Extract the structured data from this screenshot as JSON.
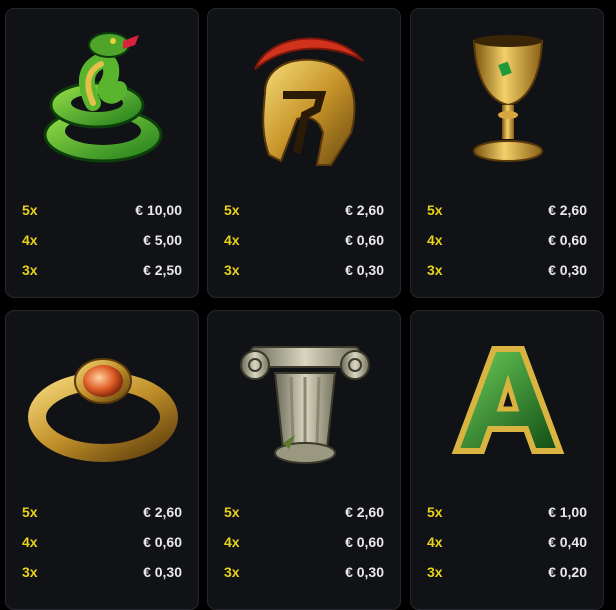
{
  "symbols": [
    {
      "icon": "snake-icon",
      "payouts": [
        {
          "mult": "5x",
          "amount": "€ 10,00"
        },
        {
          "mult": "4x",
          "amount": "€ 5,00"
        },
        {
          "mult": "3x",
          "amount": "€ 2,50"
        }
      ]
    },
    {
      "icon": "spartan-helmet-icon",
      "payouts": [
        {
          "mult": "5x",
          "amount": "€ 2,60"
        },
        {
          "mult": "4x",
          "amount": "€ 0,60"
        },
        {
          "mult": "3x",
          "amount": "€ 0,30"
        }
      ]
    },
    {
      "icon": "golden-chalice-icon",
      "payouts": [
        {
          "mult": "5x",
          "amount": "€ 2,60"
        },
        {
          "mult": "4x",
          "amount": "€ 0,60"
        },
        {
          "mult": "3x",
          "amount": "€ 0,30"
        }
      ]
    },
    {
      "icon": "gold-ring-icon",
      "payouts": [
        {
          "mult": "5x",
          "amount": "€ 2,60"
        },
        {
          "mult": "4x",
          "amount": "€ 0,60"
        },
        {
          "mult": "3x",
          "amount": "€ 0,30"
        }
      ]
    },
    {
      "icon": "ionic-column-icon",
      "payouts": [
        {
          "mult": "5x",
          "amount": "€ 2,60"
        },
        {
          "mult": "4x",
          "amount": "€ 0,60"
        },
        {
          "mult": "3x",
          "amount": "€ 0,30"
        }
      ]
    },
    {
      "icon": "letter-a-icon",
      "payouts": [
        {
          "mult": "5x",
          "amount": "€ 1,00"
        },
        {
          "mult": "4x",
          "amount": "€ 0,40"
        },
        {
          "mult": "3x",
          "amount": "€ 0,20"
        }
      ]
    }
  ],
  "colors": {
    "background": "#000000",
    "card": "#111216",
    "multiplier": "#e7d21b",
    "amount": "#e9e9ec"
  }
}
